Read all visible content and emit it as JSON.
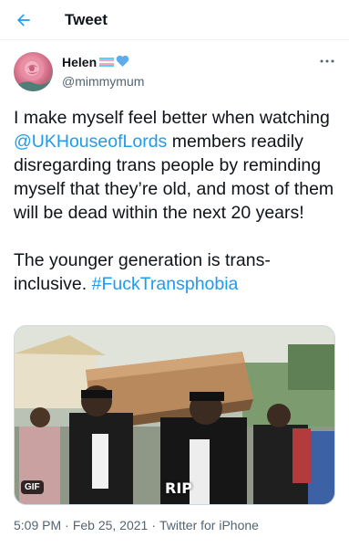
{
  "header": {
    "title": "Tweet",
    "back_icon": "back-arrow-icon"
  },
  "author": {
    "display_name": "Helen",
    "flag_icon": "transgender-flag-icon",
    "heart_icon": "blue-heart-icon",
    "handle": "@mimmymum"
  },
  "tweet": {
    "p1_before": "I make myself feel better when watching ",
    "p1_mention": "@UKHouseofLords",
    "p1_after": " members readily disregarding trans people by reminding myself that they’re old, and most of them will be dead within the next 20 years!",
    "p2_before": "The younger generation is trans-inclusive. ",
    "p2_hashtag": "#FuckTransphobia"
  },
  "media": {
    "badge": "GIF",
    "overlay_text": "RIP"
  },
  "meta": {
    "time": "5:09 PM",
    "separator": "·",
    "date": "Feb 25, 2021",
    "source": "Twitter for iPhone"
  },
  "colors": {
    "link": "#1d9bf0",
    "secondary_text": "#536471",
    "flag_blue": "#5bcefa",
    "flag_pink": "#f5a9b8",
    "heart_blue": "#5dadec"
  }
}
